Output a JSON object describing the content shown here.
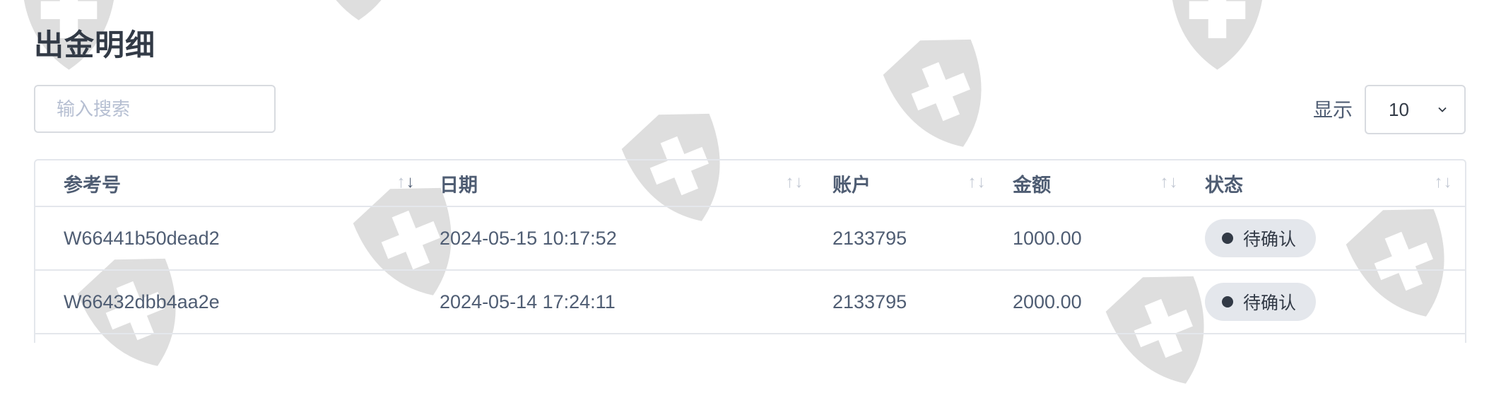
{
  "page": {
    "title": "出金明细"
  },
  "search": {
    "placeholder": "输入搜索",
    "value": ""
  },
  "page_size": {
    "label": "显示",
    "value": "10"
  },
  "table": {
    "columns": [
      {
        "label": "参考号",
        "sort": "desc"
      },
      {
        "label": "日期",
        "sort": "none"
      },
      {
        "label": "账户",
        "sort": "none"
      },
      {
        "label": "金额",
        "sort": "none"
      },
      {
        "label": "状态",
        "sort": "none"
      }
    ],
    "rows": [
      {
        "ref": "W66441b50dead2",
        "date": "2024-05-15 10:17:52",
        "account": "2133795",
        "amount": "1000.00",
        "status": "待确认"
      },
      {
        "ref": "W66432dbb4aa2e",
        "date": "2024-05-14 17:24:11",
        "account": "2133795",
        "amount": "2000.00",
        "status": "待确认"
      }
    ]
  },
  "colors": {
    "watermark": "#d5d5d5",
    "badge_bg": "#e4e7ec",
    "text": "#4f5d73",
    "title": "#323a46"
  },
  "icons": {
    "watermark": "shield-cross-icon",
    "sort": "sort-arrows-icon",
    "select": "chevron-down-icon",
    "status": "status-dot-icon"
  }
}
